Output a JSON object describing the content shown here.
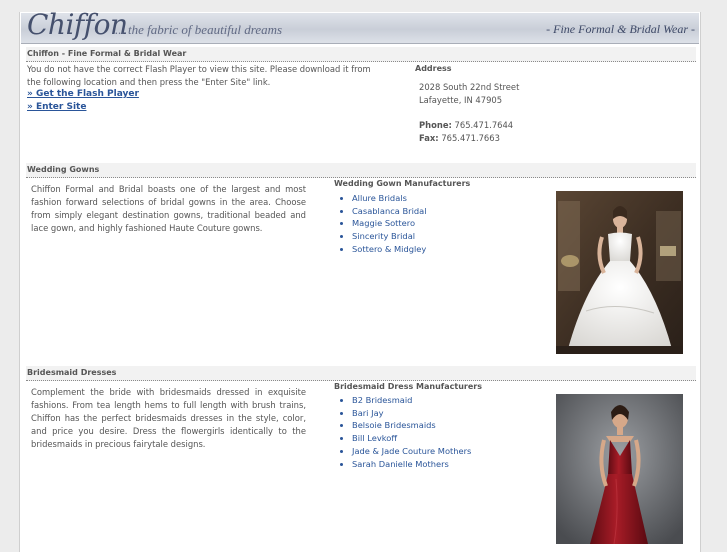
{
  "banner": {
    "logo": "Chiffon",
    "tagline": "... the fabric of beautiful dreams",
    "right_text": "- Fine Formal & Bridal Wear -"
  },
  "intro": {
    "heading": "Chiffon - Fine Formal & Bridal Wear",
    "flash_message": "You do not have the correct Flash Player to view this site. Please download it from the following location and then press the \"Enter Site\" link.",
    "get_flash_link": "» Get the Flash Player",
    "enter_site_link": "» Enter Site"
  },
  "address": {
    "heading": "Address",
    "street": "2028 South 22nd Street",
    "city": "Lafayette, IN 47905",
    "phone_label": "Phone:",
    "phone": "765.471.7644",
    "fax_label": "Fax:",
    "fax": "765.471.7663"
  },
  "wedding": {
    "heading": "Wedding Gowns",
    "description": "Chiffon Formal and Bridal boasts one of the largest and most fashion forward selections of bridal gowns in the area. Choose from simply elegant destination gowns, traditional beaded and lace gown, and highly fashioned Haute Couture gowns.",
    "manufacturers_heading": "Wedding Gown Manufacturers",
    "manufacturers": [
      "Allure Bridals",
      "Casablanca Bridal",
      "Maggie Sottero",
      "Sincerity Bridal",
      "Sottero & Midgley"
    ]
  },
  "bridesmaid": {
    "heading": "Bridesmaid Dresses",
    "description": "Complement the bride with bridesmaids dressed in exquisite fashions. From tea length hems to full length with brush trains, Chiffon has the perfect bridesmaids dresses in the style, color, and price you desire. Dress the flowergirls identically to the bridesmaids in precious fairytale designs.",
    "manufacturers_heading": "Bridesmaid Dress Manufacturers",
    "manufacturers": [
      "B2 Bridesmaid",
      "Bari Jay",
      "Belsoie Bridesmaids",
      "Bill Levkoff",
      "Jade & Jade Couture Mothers",
      "Sarah Danielle Mothers"
    ]
  },
  "colors": {
    "link": "#2a5599",
    "banner": "#c9ced8",
    "logo": "#45506d",
    "dress_red": "#8e1620"
  }
}
